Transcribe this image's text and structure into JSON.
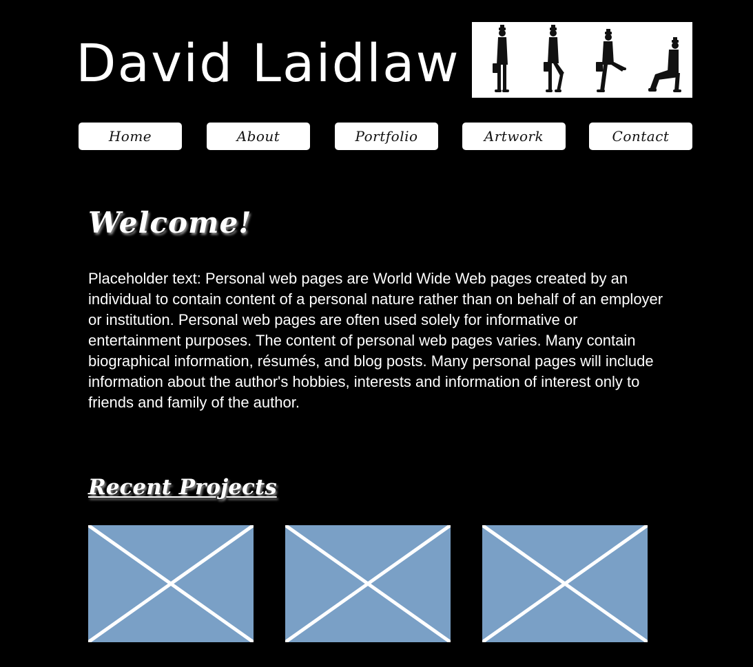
{
  "header": {
    "site_title": "David Laidlaw",
    "banner_image": "silly-walk-figures-icon"
  },
  "nav": {
    "items": [
      {
        "label": "Home"
      },
      {
        "label": "About"
      },
      {
        "label": "Portfolio"
      },
      {
        "label": "Artwork"
      },
      {
        "label": "Contact"
      }
    ]
  },
  "main": {
    "welcome_heading": "Welcome!",
    "intro_text": "Placeholder text: Personal web pages are World Wide Web pages created by an individual to contain content of a personal nature rather than on behalf of an employer or institution. Personal web pages are often used solely for informative or entertainment purposes. The content of personal web pages varies. Many contain biographical information, résumés, and blog posts. Many personal pages will include information about the author's hobbies, interests and information of interest only to friends and family of the author.",
    "projects_heading": "Recent Projects",
    "projects": [
      {
        "thumbnail": "image-placeholder-icon"
      },
      {
        "thumbnail": "image-placeholder-icon"
      },
      {
        "thumbnail": "image-placeholder-icon"
      }
    ]
  },
  "colors": {
    "background": "#000000",
    "text": "#ffffff",
    "nav_button_bg": "#ffffff",
    "nav_button_text": "#111111",
    "placeholder_bg": "#7aa0c6",
    "placeholder_cross": "#ffffff"
  }
}
